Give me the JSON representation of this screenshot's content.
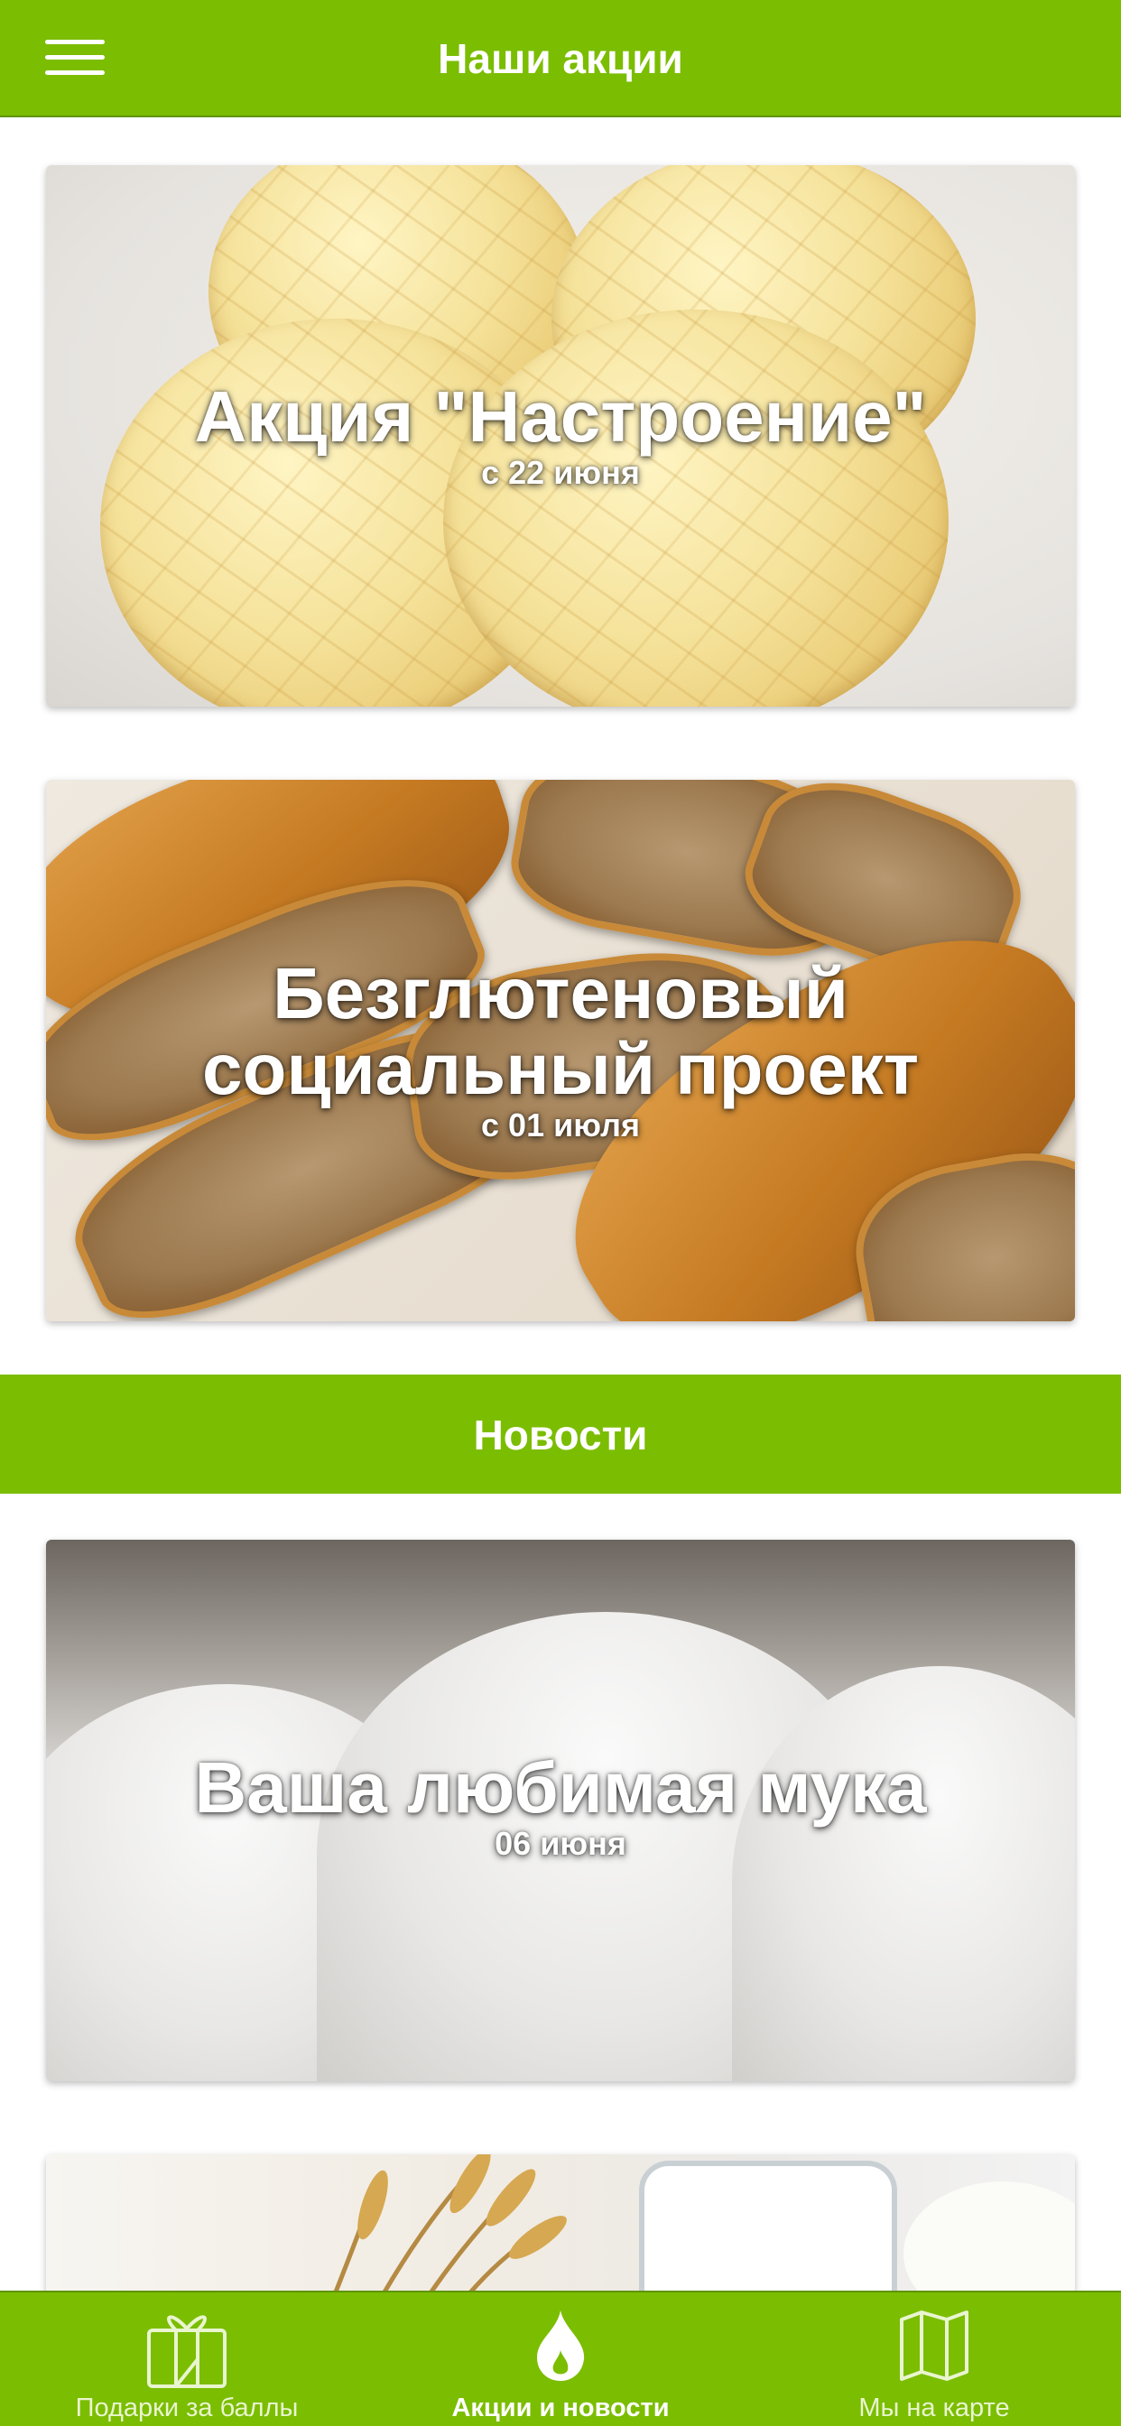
{
  "header": {
    "title": "Наши акции",
    "menu_icon": "hamburger-menu-icon"
  },
  "promotions": [
    {
      "title": "Акция \"Настроение\"",
      "date": "с 22 июня"
    },
    {
      "title_line1": "Безглютеновый",
      "title_line2": "социальный проект",
      "date": "с 01 июля"
    }
  ],
  "news_section": {
    "label": "Новости"
  },
  "news": [
    {
      "title": "Ваша любимая мука",
      "date": "06 июня"
    }
  ],
  "tabbar": {
    "tabs": [
      {
        "label": "Подарки за баллы",
        "icon": "gift-icon",
        "active": false
      },
      {
        "label": "Акции и новости",
        "icon": "flame-icon",
        "active": true
      },
      {
        "label": "Мы на карте",
        "icon": "map-icon",
        "active": false
      }
    ]
  },
  "colors": {
    "brand_green": "#7bbd00",
    "text_on_brand": "#ffffff"
  }
}
